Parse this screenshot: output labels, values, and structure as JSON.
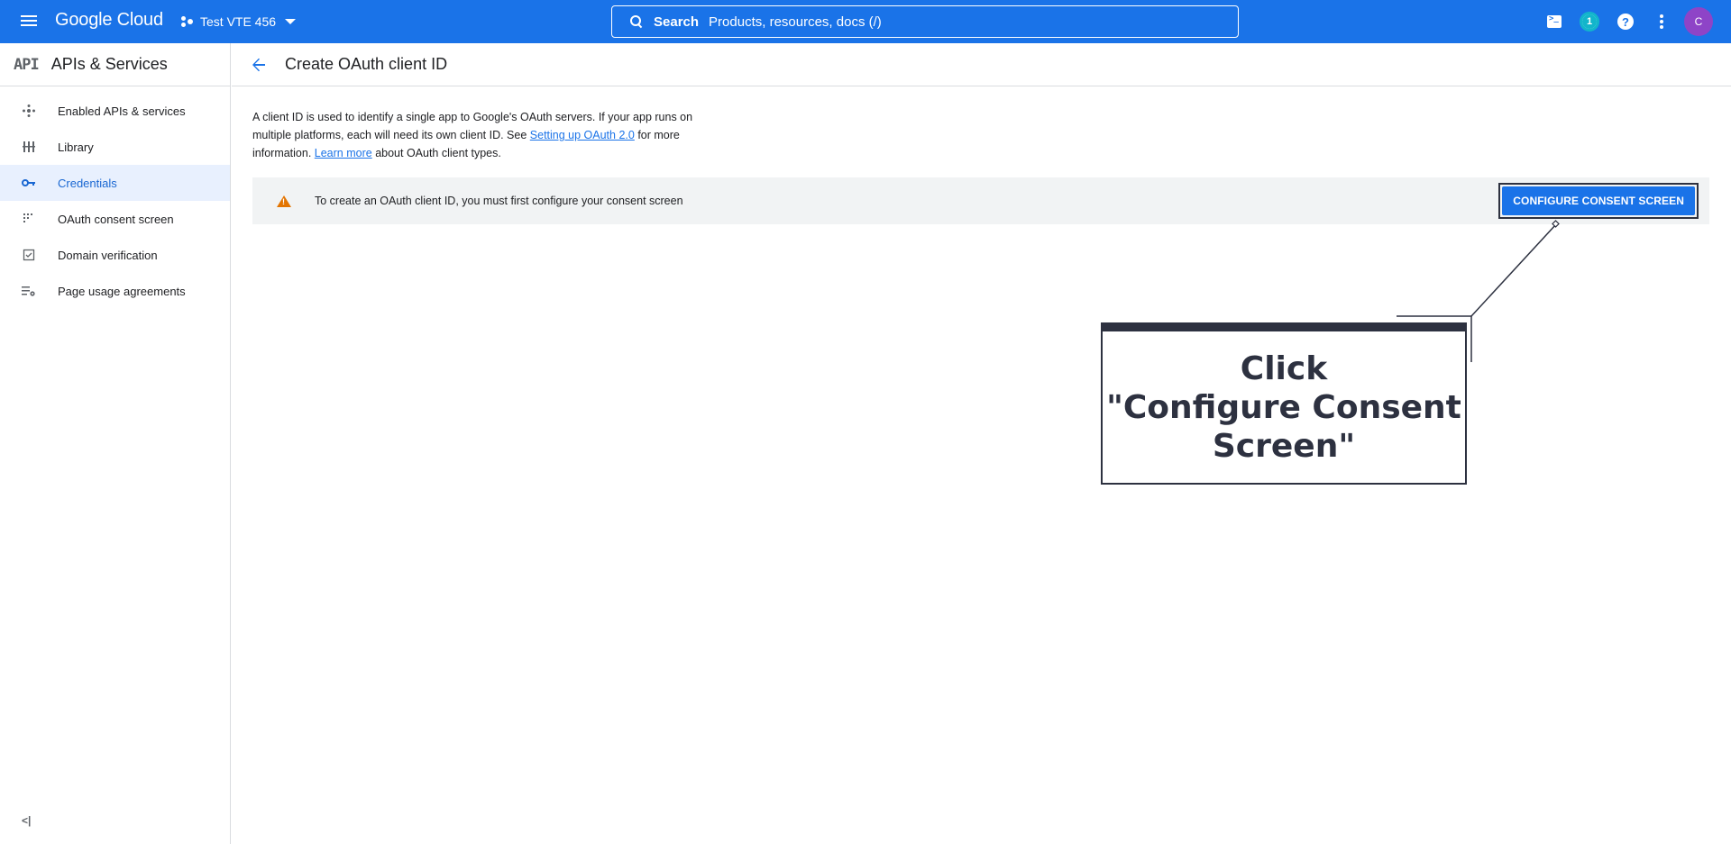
{
  "topbar": {
    "logo_text": "Google Cloud",
    "project_name": "Test VTE 456",
    "search_label": "Search",
    "search_placeholder": "Products, resources, docs (/)",
    "notification_count": "1",
    "avatar_initial": "C",
    "help_glyph": "?",
    "brand_color": "#1a73e8"
  },
  "sidebar": {
    "logo_text": "API",
    "title": "APIs & Services",
    "items": [
      {
        "label": "Enabled APIs & services",
        "icon": "enabled-apis-icon",
        "active": false
      },
      {
        "label": "Library",
        "icon": "library-icon",
        "active": false
      },
      {
        "label": "Credentials",
        "icon": "key-icon",
        "active": true
      },
      {
        "label": "OAuth consent screen",
        "icon": "consent-screen-icon",
        "active": false
      },
      {
        "label": "Domain verification",
        "icon": "domain-verification-icon",
        "active": false
      },
      {
        "label": "Page usage agreements",
        "icon": "settings-list-icon",
        "active": false
      }
    ],
    "collapse_glyph": "<|"
  },
  "header": {
    "title": "Create OAuth client ID"
  },
  "intro": {
    "text_1": "A client ID is used to identify a single app to Google's OAuth servers. If your app runs on multiple platforms, each will need its own client ID. See ",
    "link_1": "Setting up OAuth 2.0",
    "text_2": " for more information. ",
    "link_2": "Learn more",
    "text_3": " about OAuth client types."
  },
  "notice": {
    "text": "To create an OAuth client ID, you must first configure your consent screen",
    "button_label": "CONFIGURE CONSENT SCREEN",
    "warning_color": "#e37400"
  },
  "annotation": {
    "text": "Click\n\"Configure Consent\nScreen\""
  }
}
